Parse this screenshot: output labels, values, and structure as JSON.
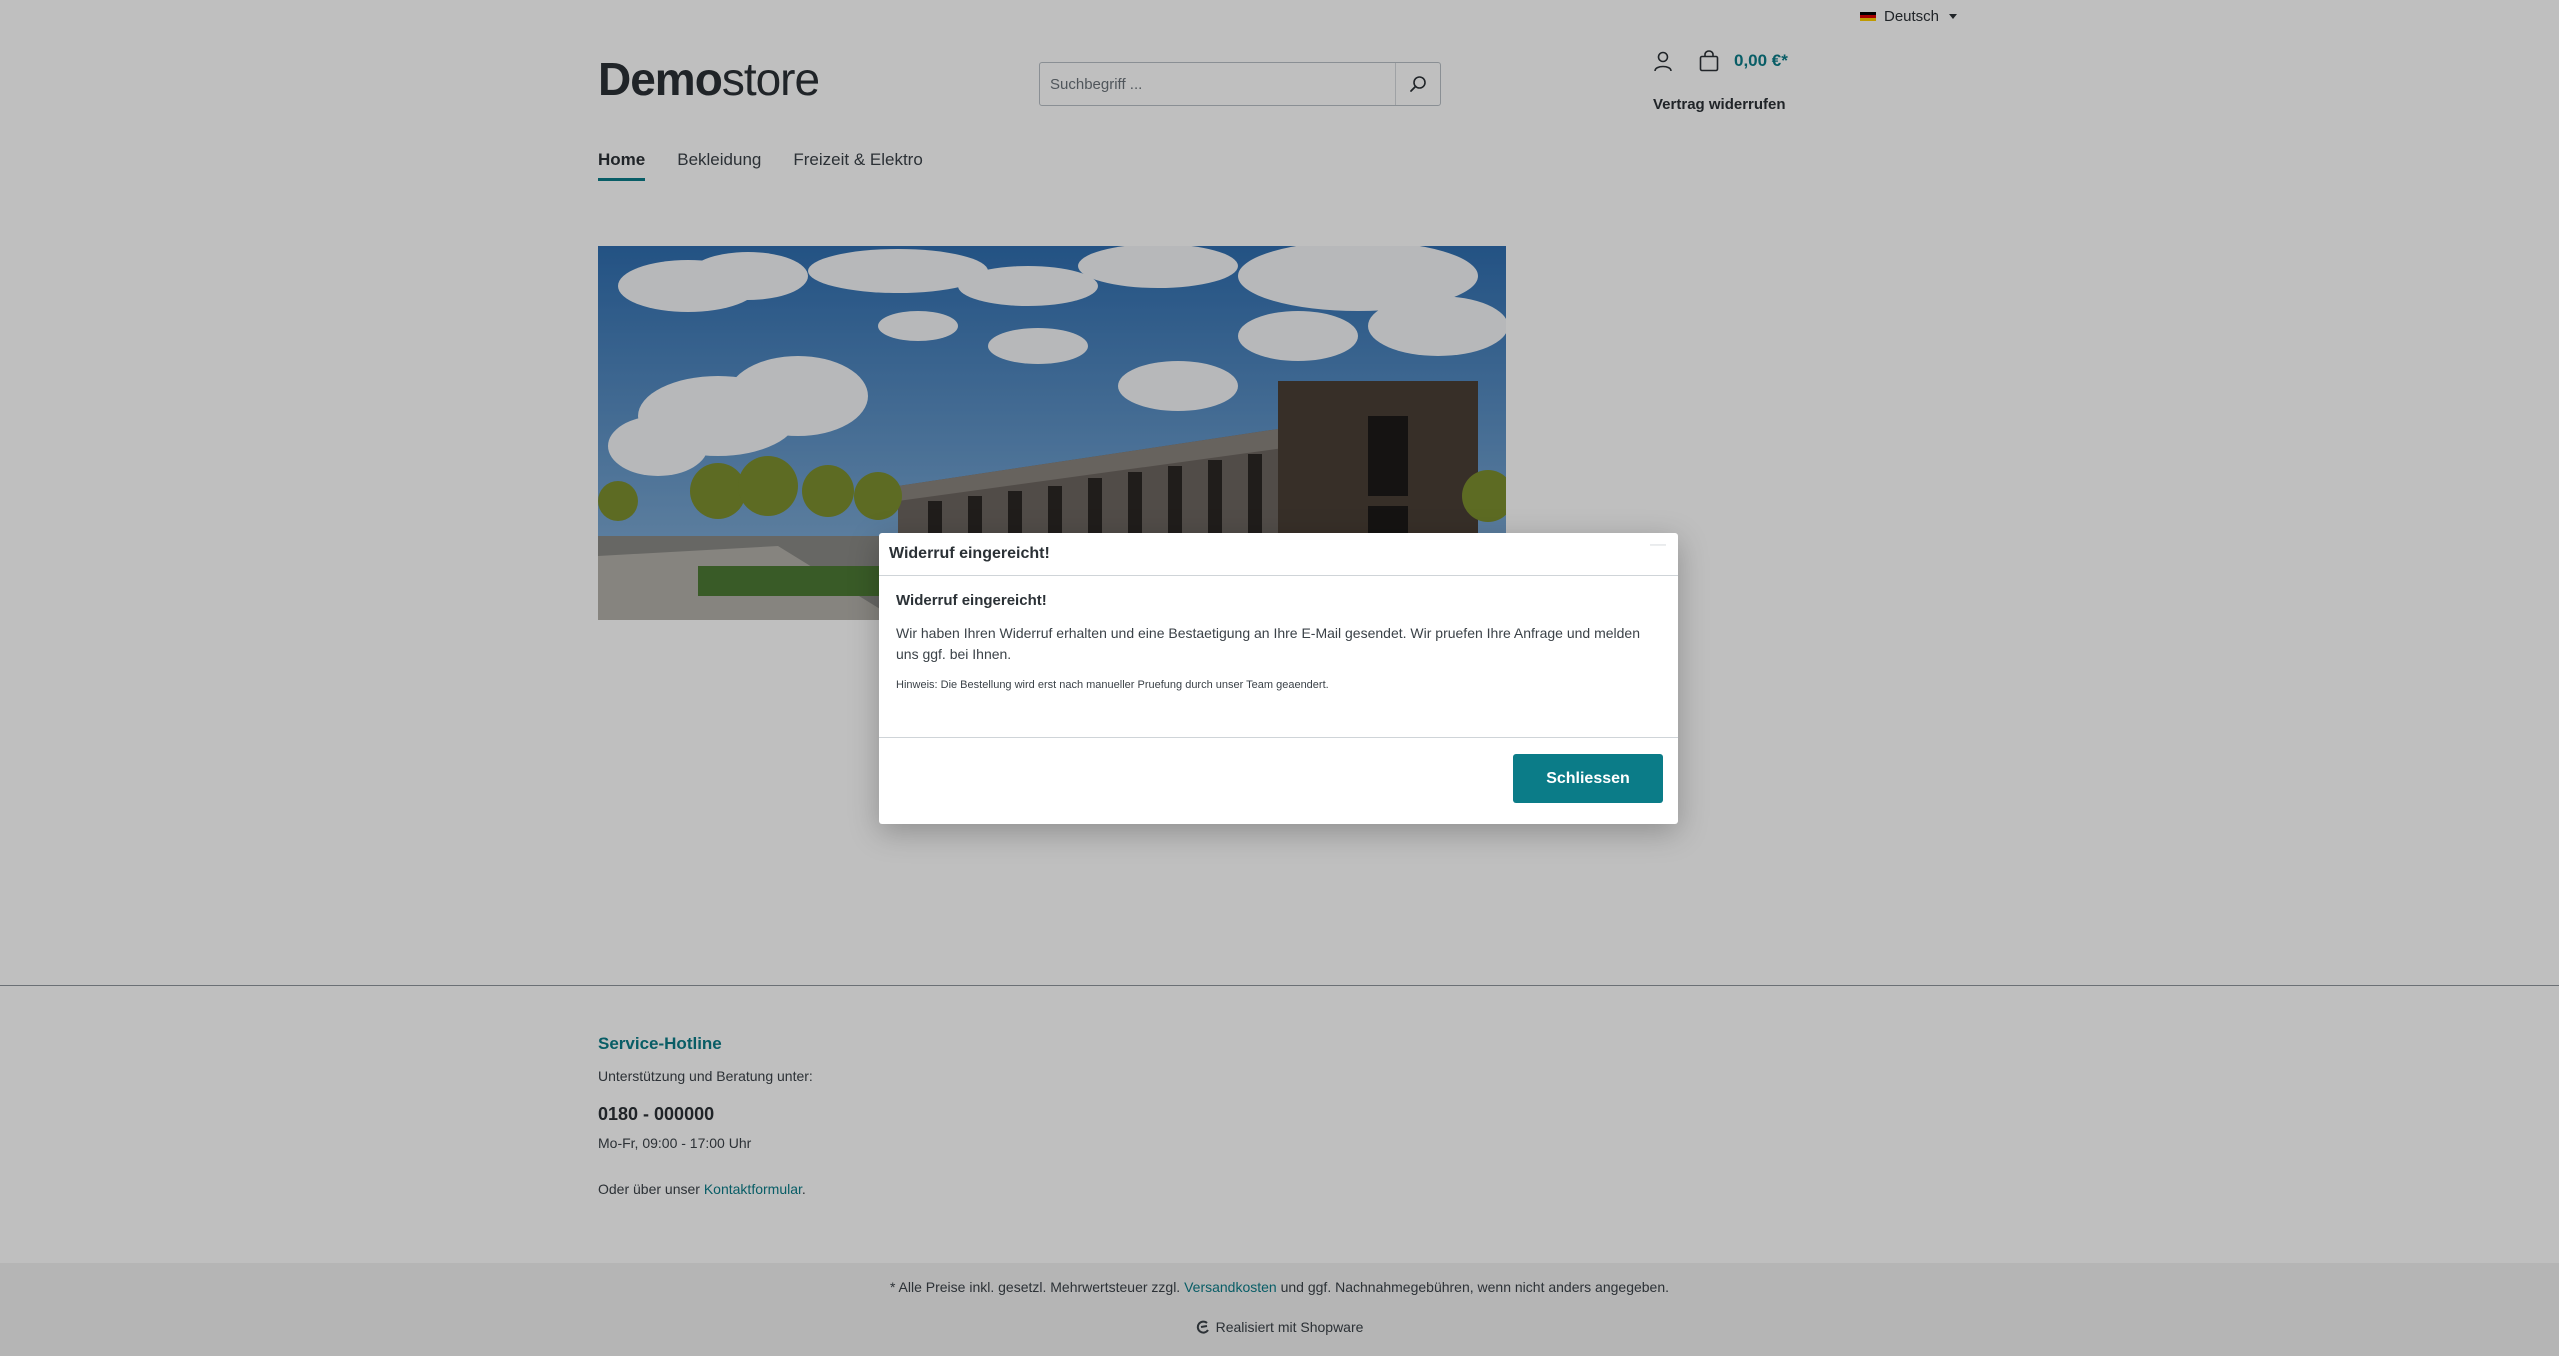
{
  "language": {
    "label": "Deutsch",
    "flag_colors": [
      "#000000",
      "#dd0000",
      "#ffce00"
    ]
  },
  "header": {
    "logo_bold": "Demo",
    "logo_regular": "store",
    "search_placeholder": "Suchbegriff ...",
    "cart_total": "0,00 €*",
    "revoke_link": "Vertrag widerrufen"
  },
  "nav": {
    "items": [
      {
        "label": "Home",
        "active": true
      },
      {
        "label": "Bekleidung",
        "active": false
      },
      {
        "label": "Freizeit & Elektro",
        "active": false
      }
    ]
  },
  "footer": {
    "hotline_title": "Service-Hotline",
    "support_text": "Unterstützung und Beratung unter:",
    "phone": "0180 - 000000",
    "hours": "Mo-Fr, 09:00 - 17:00 Uhr",
    "contact_prefix": "Oder über unser ",
    "contact_link": "Kontaktformular",
    "contact_suffix": "."
  },
  "bottom": {
    "vat_prefix": "* Alle Preise inkl. gesetzl. Mehrwertsteuer zzgl. ",
    "vat_link": "Versandkosten",
    "vat_suffix": " und ggf. Nachnahmegebühren, wenn nicht anders angegeben.",
    "powered": "Realisiert mit Shopware"
  },
  "modal": {
    "title": "Widerruf eingereicht!",
    "subtitle": "Widerruf eingereicht!",
    "message": "Wir haben Ihren Widerruf erhalten und eine Bestaetigung an Ihre E-Mail gesendet. Wir pruefen Ihre Anfrage und melden uns ggf. bei Ihnen.",
    "note": "Hinweis: Die Bestellung wird erst nach manueller Pruefung durch unser Team geaendert.",
    "close_button": "Schliessen"
  },
  "colors": {
    "accent": "#0b7c88",
    "text": "#2b3136"
  }
}
